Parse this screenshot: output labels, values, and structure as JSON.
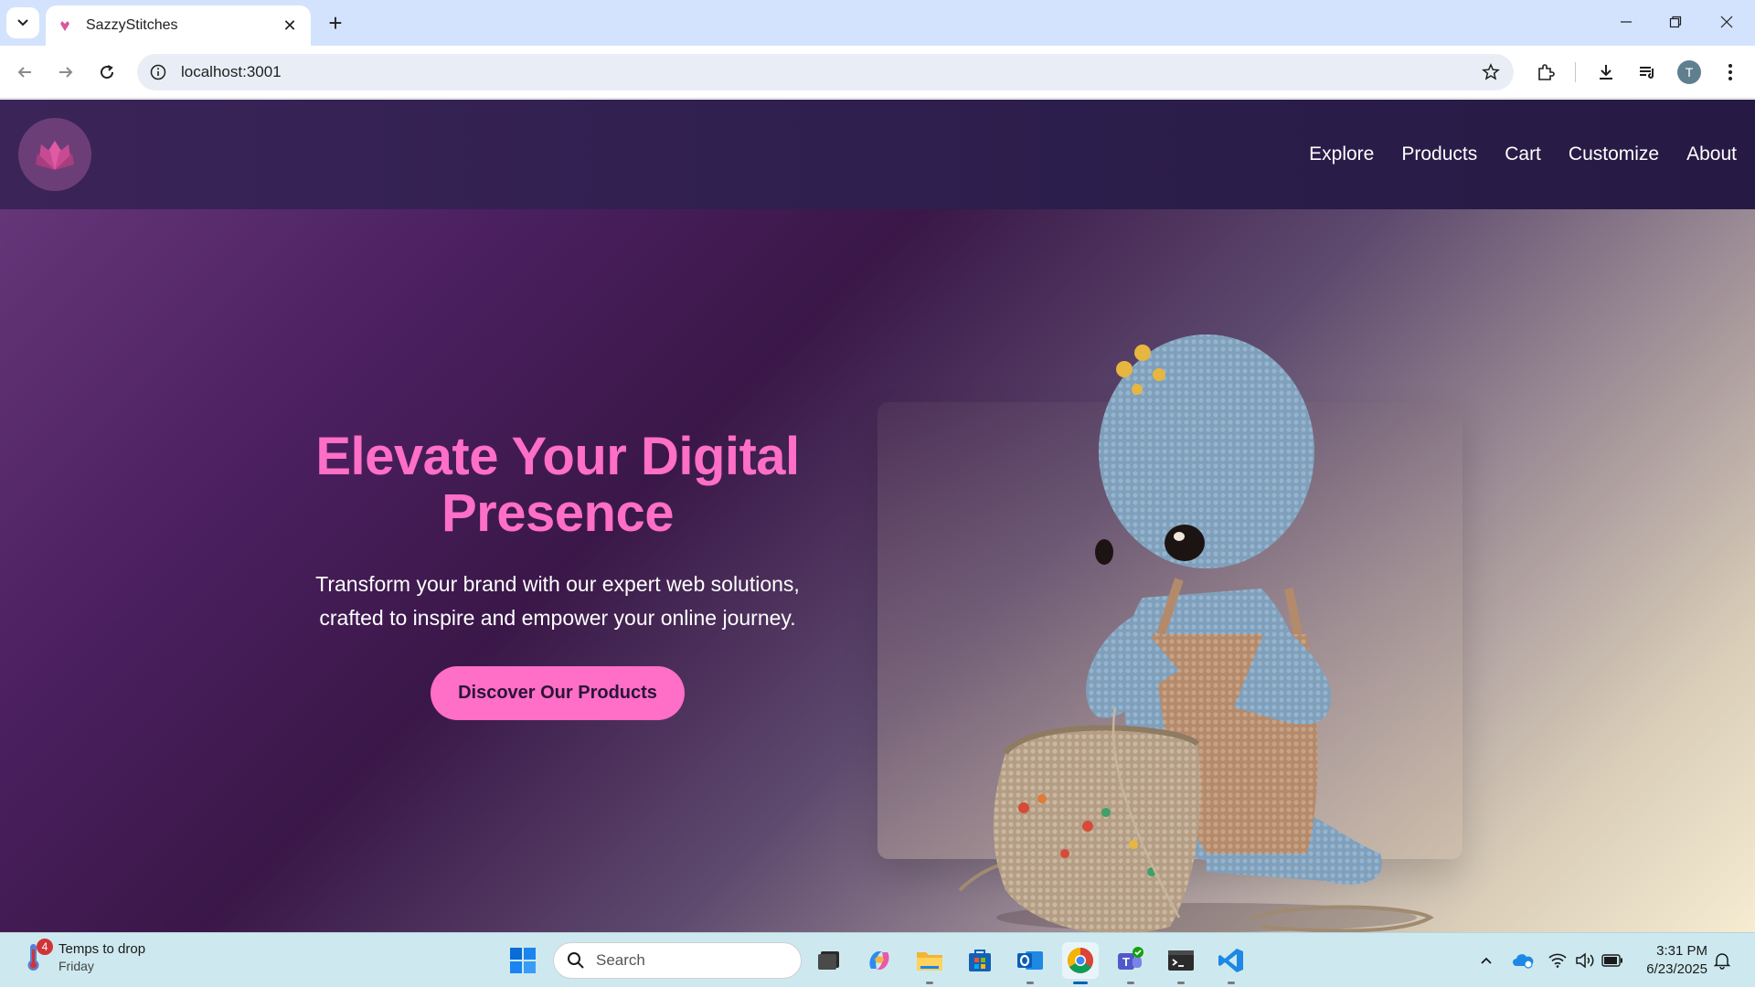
{
  "browser": {
    "tab_title": "SazzyStitches",
    "url": "localhost:3001",
    "profile_initial": "T"
  },
  "site": {
    "nav": [
      "Explore",
      "Products",
      "Cart",
      "Customize",
      "About"
    ],
    "hero": {
      "title": "Elevate Your Digital Presence",
      "subtitle": "Transform your brand with our expert web solutions, crafted to inspire and empower your online journey.",
      "cta": "Discover Our Products"
    },
    "colors": {
      "accent": "#ff6ec7",
      "header": "#2e1f4e"
    }
  },
  "taskbar": {
    "weather_badge": "4",
    "weather_line1": "Temps to drop",
    "weather_line2": "Friday",
    "search_placeholder": "Search",
    "time": "3:31 PM",
    "date": "6/23/2025",
    "apps": [
      "start-icon",
      "task-view-icon",
      "copilot-icon",
      "file-explorer-icon",
      "store-icon",
      "outlook-icon",
      "chrome-icon",
      "teams-icon",
      "terminal-icon",
      "vscode-icon"
    ]
  }
}
